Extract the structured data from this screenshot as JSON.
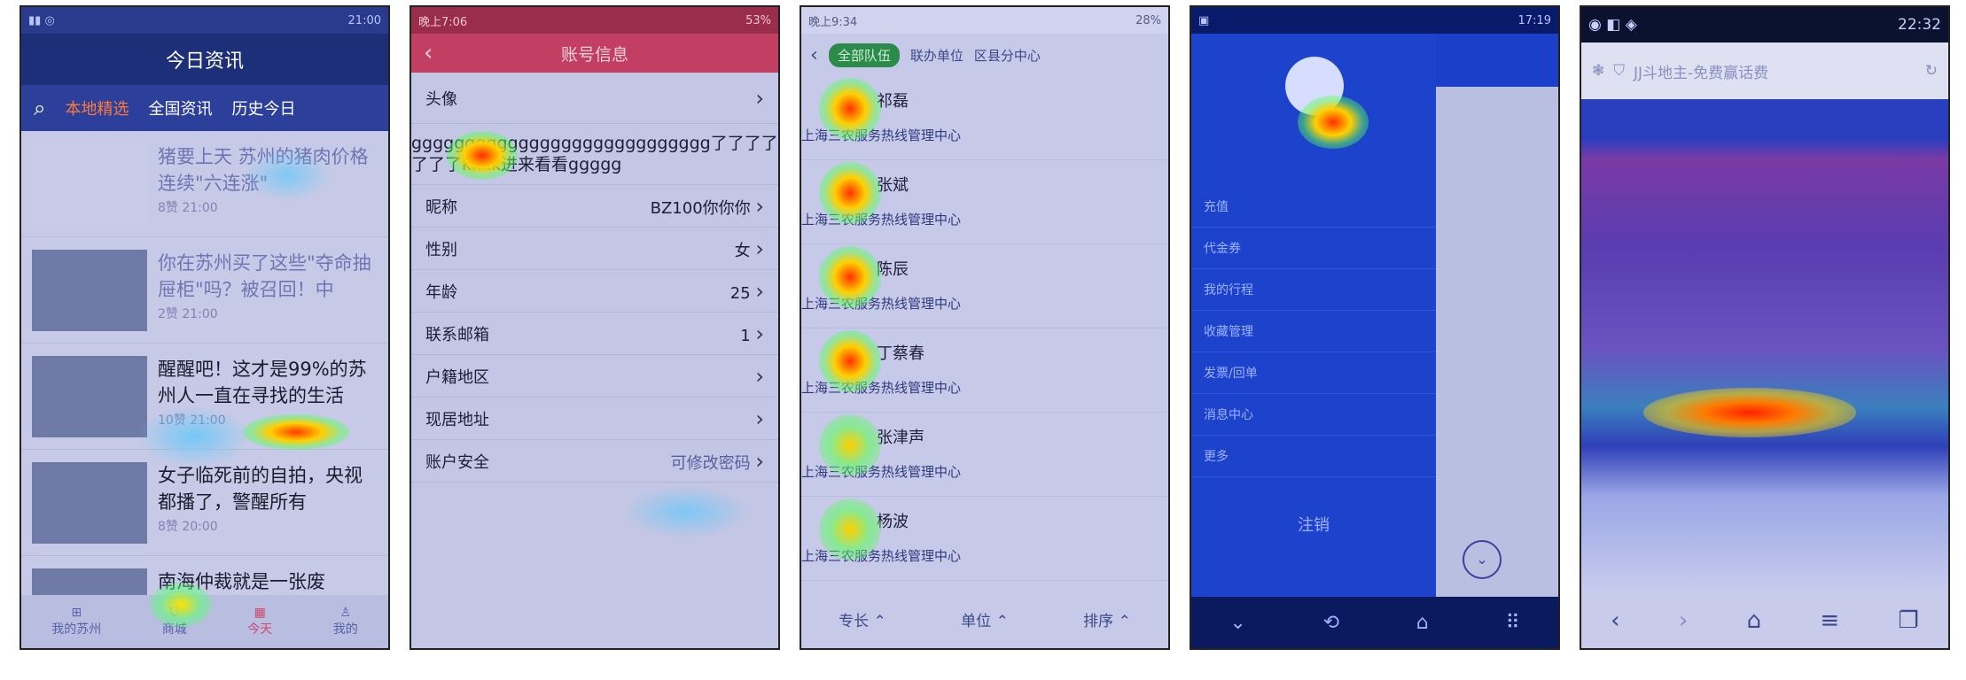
{
  "phone1": {
    "status": "本地精选",
    "title": "今日资讯",
    "tabs": [
      "本地精选",
      "全国资讯",
      "历史今日"
    ],
    "news": [
      {
        "text": "猪要上天 苏州的猪肉价格连续\"六连涨\"",
        "meta": "8赞 21:00"
      },
      {
        "text": "你在苏州买了这些\"夺命抽屉柜\"吗？被召回！中",
        "meta": "2赞 21:00"
      },
      {
        "text": "醒醒吧！这才是99%的苏州人一直在寻找的生活",
        "meta": "10赞 21:00"
      },
      {
        "text": "女子临死前的自拍，央视都播了，警醒所有",
        "meta": "8赞 20:00"
      },
      {
        "text": "南海仲裁就是一张废",
        "meta": ""
      }
    ],
    "nav": [
      "我的苏州",
      "商城",
      "今天",
      "我的"
    ]
  },
  "phone2": {
    "header": "账号信息",
    "avatar_label": "头像",
    "long_text": "gggggggggggggggggggggggggggg了了了了了了了kkkk进来看看ggggg",
    "rows": [
      {
        "label": "昵称",
        "value": "BZ100你你你"
      },
      {
        "label": "性别",
        "value": "女"
      },
      {
        "label": "年龄",
        "value": "25"
      },
      {
        "label": "联系邮箱",
        "value": "1"
      },
      {
        "label": "户籍地区",
        "value": ""
      },
      {
        "label": "现居地址",
        "value": ""
      },
      {
        "label": "账户安全",
        "value": "可修改密码"
      }
    ]
  },
  "phone3": {
    "tabs": [
      "全部队伍",
      "联办单位",
      "区县分中心"
    ],
    "contacts": [
      {
        "name": "祁磊",
        "org": "上海三农服务热线管理中心"
      },
      {
        "name": "张斌",
        "org": "上海三农服务热线管理中心"
      },
      {
        "name": "陈辰",
        "org": "上海三农服务热线管理中心"
      },
      {
        "name": "丁蔡春",
        "org": "上海三农服务热线管理中心"
      },
      {
        "name": "张津声",
        "org": "上海三农服务热线管理中心"
      },
      {
        "name": "杨波",
        "org": "上海三农服务热线管理中心"
      }
    ],
    "footer": [
      "专长",
      "单位",
      "排序"
    ]
  },
  "phone4": {
    "time": "17:19",
    "menu": [
      "充值",
      "代金券",
      "我的行程",
      "收藏管理",
      "发票/回单",
      "消息中心",
      "更多"
    ],
    "logout": "注销"
  },
  "phone5": {
    "time": "22:32",
    "url_title": "JJ斗地主-免费赢话费",
    "nav_icons": [
      "back-icon",
      "forward-icon",
      "home-icon",
      "menu-icon",
      "tabs-icon"
    ]
  }
}
